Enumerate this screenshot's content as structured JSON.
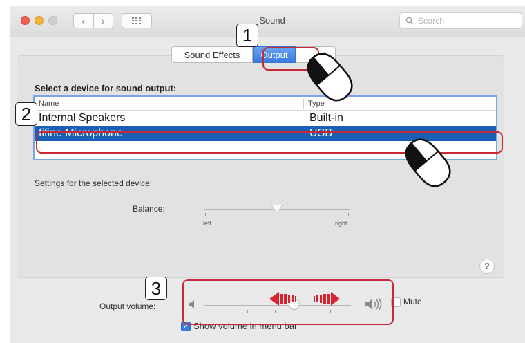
{
  "window": {
    "title": "Sound",
    "search_placeholder": "Search",
    "nav_back_glyph": "‹",
    "nav_forward_glyph": "›"
  },
  "tabs": [
    {
      "label": "Sound Effects",
      "selected": false
    },
    {
      "label": "Output",
      "selected": true
    },
    {
      "label": "Input",
      "selected": false,
      "visible_text": "ut"
    }
  ],
  "output": {
    "heading": "Select a device for sound output:",
    "columns": [
      "Name",
      "Type"
    ],
    "devices": [
      {
        "name": "Internal Speakers",
        "type": "Built-in",
        "selected": false
      },
      {
        "name": "fifine Microphone",
        "type": "USB",
        "selected": true
      }
    ],
    "settings_label": "Settings for the selected device:",
    "balance": {
      "label": "Balance:",
      "left_label": "left",
      "right_label": "right",
      "value": 0.5
    }
  },
  "help_glyph": "?",
  "volume": {
    "label": "Output volume:",
    "value": 0.6,
    "mute_label": "Mute",
    "muted": false
  },
  "menu_bar": {
    "label": "Show volume in menu bar",
    "checked": true
  },
  "callouts": [
    "1",
    "2",
    "3"
  ],
  "colors": {
    "highlight": "#c62a35",
    "selection": "#1a5eb6",
    "accent": "#3a7be0",
    "arrow": "#d92330"
  },
  "icons": [
    "search-icon",
    "grid-icon",
    "speaker-low-icon",
    "speaker-high-icon",
    "mouse-click-icon"
  ]
}
